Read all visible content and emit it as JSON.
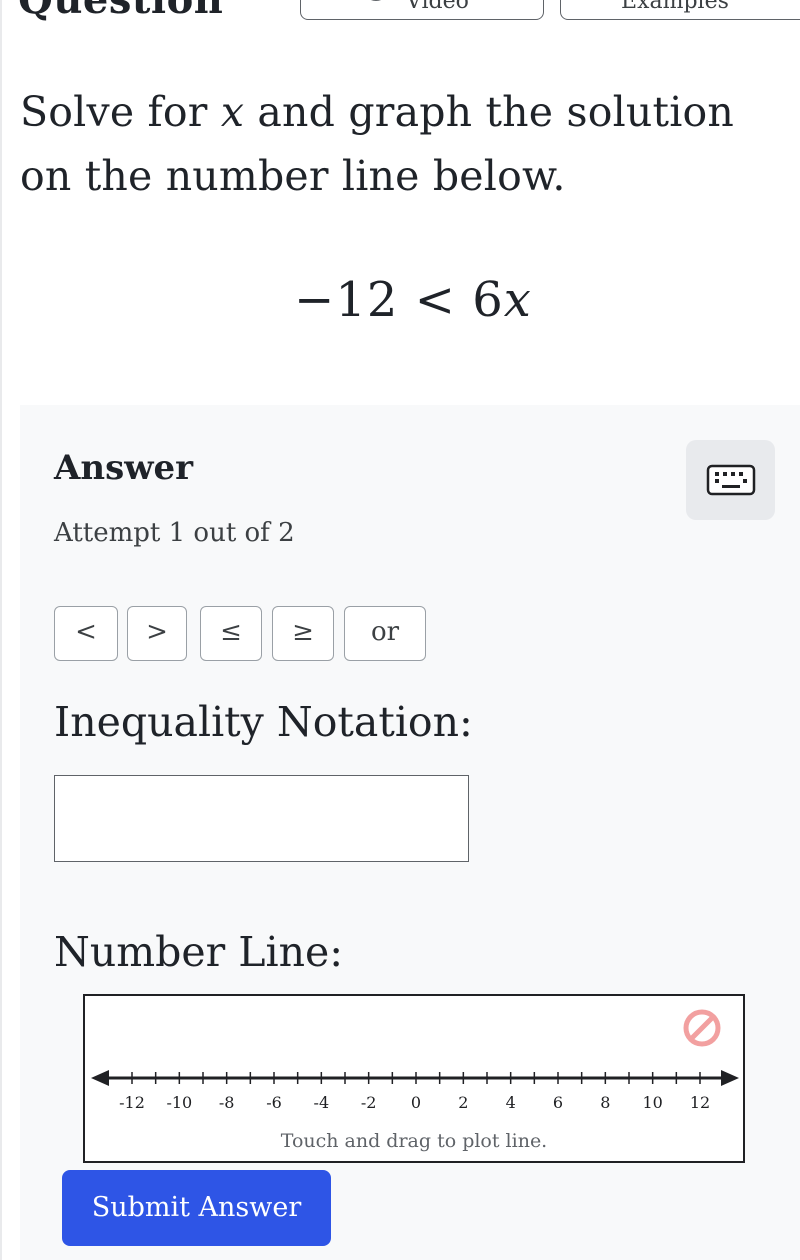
{
  "top_bar": {
    "heading_clipped": "Question",
    "video_tab_label": "Video",
    "example_tab_label": "Examples"
  },
  "question": {
    "text_before": "Solve for ",
    "variable": "x",
    "text_after": " and graph the solution on the number line below.",
    "equation_left": "−12 < 6",
    "equation_var": "x"
  },
  "answer": {
    "heading": "Answer",
    "keyboard_icon": "keyboard-icon",
    "attempt": "Attempt 1 out of 2",
    "symbol_buttons": [
      "<",
      ">",
      "≤",
      "≥",
      "or"
    ],
    "inequality_label": "Inequality Notation:",
    "inequality_value": "",
    "number_line_label": "Number Line:",
    "number_line": {
      "min": -12,
      "max": 12,
      "tick_labels": [
        "-12",
        "-10",
        "-8",
        "-6",
        "-4",
        "-2",
        "0",
        "2",
        "4",
        "6",
        "8",
        "10",
        "12"
      ],
      "hint": "Touch and drag to plot line.",
      "clear_icon": "no-entry-icon"
    },
    "submit_label": "Submit Answer"
  },
  "colors": {
    "submit_bg": "#2e55e6",
    "clear_icon": "#f2a0a0",
    "panel_bg": "#f8f9fa"
  }
}
